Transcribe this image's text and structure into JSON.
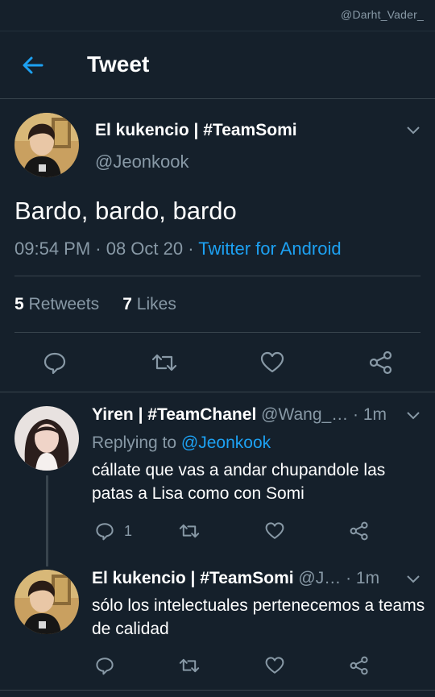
{
  "watermark": "@Darht_Vader_",
  "header": {
    "title": "Tweet"
  },
  "main_tweet": {
    "name": "El kukencio | #TeamSomi",
    "handle": "@Jeonkook",
    "text": "Bardo, bardo, bardo",
    "time": "09:54 PM · 08 Oct 20 ·",
    "source": "Twitter for Android",
    "retweets_count": "5",
    "retweets_label": "Retweets",
    "likes_count": "7",
    "likes_label": "Likes"
  },
  "replies": [
    {
      "name": "Yiren | #TeamChanel",
      "handle": "@Wang_…",
      "time": "· 1m",
      "replying_prefix": "Replying to",
      "replying_to": "@Jeonkook",
      "text": "cállate que vas a andar chupandole las patas a Lisa como con Somi",
      "reply_count": "1"
    },
    {
      "name": "El kukencio | #TeamSomi",
      "handle": "@J…",
      "time": "· 1m",
      "text": "sólo los intelectuales pertenecemos a teams de calidad"
    }
  ],
  "colors": {
    "background": "#15202b",
    "accent": "#1da1f2",
    "muted": "#8899a6",
    "divider": "#38444d"
  }
}
